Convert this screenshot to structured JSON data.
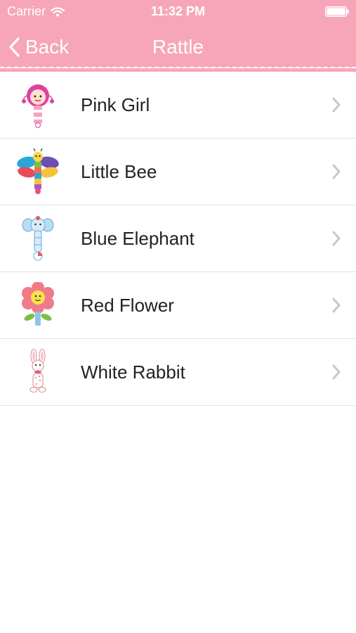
{
  "status_bar": {
    "carrier": "Carrier",
    "time": "11:32 PM"
  },
  "nav": {
    "back_label": "Back",
    "title": "Rattle"
  },
  "items": [
    {
      "label": "Pink Girl",
      "icon": "pink-girl-rattle-icon"
    },
    {
      "label": "Little Bee",
      "icon": "little-bee-rattle-icon"
    },
    {
      "label": "Blue Elephant",
      "icon": "blue-elephant-rattle-icon"
    },
    {
      "label": "Red Flower",
      "icon": "red-flower-rattle-icon"
    },
    {
      "label": "White Rabbit",
      "icon": "white-rabbit-rattle-icon"
    }
  ],
  "colors": {
    "theme_pink": "#f7a6b9",
    "text": "#222222",
    "chevron": "#c7c7cc",
    "separator": "#e2e2e2"
  }
}
